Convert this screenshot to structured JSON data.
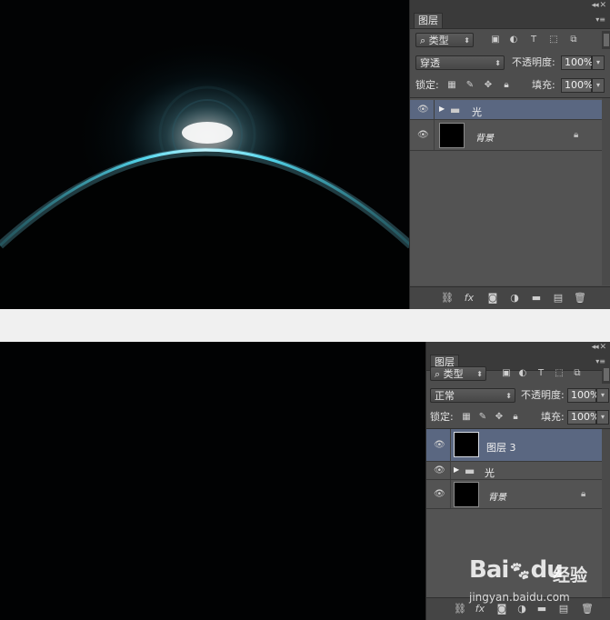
{
  "top": {
    "panel": {
      "tab": "图层",
      "filter_label": "类型",
      "blend_mode": "穿透",
      "opacity_label": "不透明度:",
      "opacity_value": "100%",
      "lock_label": "锁定:",
      "fill_label": "填充:",
      "fill_value": "100%",
      "layers": [
        {
          "name": "光",
          "type": "group",
          "selected": true
        },
        {
          "name": "背景",
          "type": "background",
          "selected": false
        }
      ]
    }
  },
  "bottom": {
    "panel": {
      "tab": "图层",
      "filter_label": "类型",
      "blend_mode": "正常",
      "opacity_label": "不透明度:",
      "opacity_value": "100%",
      "lock_label": "锁定:",
      "fill_label": "填充:",
      "fill_value": "100%",
      "layers": [
        {
          "name": "图层 3",
          "type": "layer",
          "selected": true
        },
        {
          "name": "光",
          "type": "group",
          "selected": false
        },
        {
          "name": "背景",
          "type": "background",
          "selected": false
        }
      ]
    }
  },
  "watermark": {
    "brand": "Bai",
    "brand_paw": "du",
    "brand_cn": "经验",
    "url": "jingyan.baidu.com"
  },
  "colors": {
    "glow": "#7fe6ff",
    "selected_layer": "#5a6781",
    "panel_bg": "#4d4d4d"
  },
  "icons": [
    "eye-icon",
    "folder-icon",
    "lock-icon",
    "search-icon",
    "link-icon",
    "fx-icon",
    "mask-icon",
    "adjustment-icon",
    "new-group-icon",
    "new-layer-icon",
    "trash-icon"
  ]
}
